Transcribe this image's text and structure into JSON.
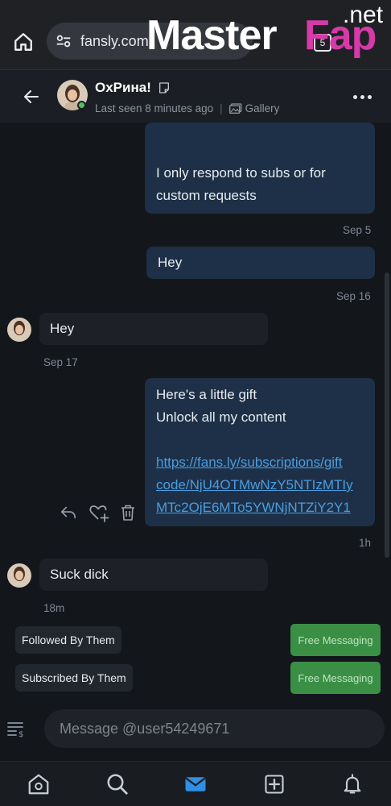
{
  "browser": {
    "url": "fansly.com",
    "tabs_count": "5",
    "home_icon": "home-icon",
    "site_settings_icon": "site-settings-icon",
    "watermark": {
      "part1": "Master",
      "part2": "Fap",
      "part3": ".net"
    }
  },
  "chat_header": {
    "name": "ОхРина!",
    "last_seen": "Last seen 8 minutes ago",
    "separator": "|",
    "gallery_label": "Gallery",
    "online": true
  },
  "messages": [
    {
      "direction": "out",
      "text_lines": [
        "I only respond to subs or for",
        "custom requests"
      ],
      "time": "Sep 5"
    },
    {
      "direction": "out",
      "text_lines": [
        "Hey"
      ],
      "time": "Sep 16"
    },
    {
      "direction": "in",
      "text_lines": [
        "Hey"
      ],
      "time": "Sep 17"
    },
    {
      "direction": "out",
      "text_lines": [
        "Here's a little gift",
        "Unlock all my content"
      ],
      "link": "https://fans.ly/subscriptions/giftcode/NjU4OTMwNzY5NTIzMTIyMTc2OjE6MTo5YWNjNTZiY2Y1",
      "link_lines": [
        "https://fans.ly/subscriptions/gift",
        "code/NjU4OTMwNzY5NTIzMTIy",
        "MTc2OjE6MTo5YWNjNTZiY2Y1"
      ],
      "time": "1h"
    },
    {
      "direction": "in",
      "text_lines": [
        "Suck dick"
      ],
      "time": "18m"
    }
  ],
  "status_rows": [
    {
      "label": "Followed By Them",
      "button": "Free Messaging"
    },
    {
      "label": "Subscribed By Them",
      "button": "Free Messaging"
    }
  ],
  "composer": {
    "placeholder": "Message @user54249671"
  },
  "nav": {
    "items": [
      "home-icon",
      "search-icon",
      "messages-icon",
      "create-post-icon",
      "notifications-icon"
    ],
    "active": "messages-icon"
  },
  "colors": {
    "background": "#13161b",
    "outgoing_bubble": "#1e3047",
    "incoming_bubble": "#1d2026",
    "accent_blue": "#2f8ee6",
    "link": "#4a9de0",
    "free_messaging_green": "#3a8f45",
    "online_green": "#4cc35a"
  }
}
